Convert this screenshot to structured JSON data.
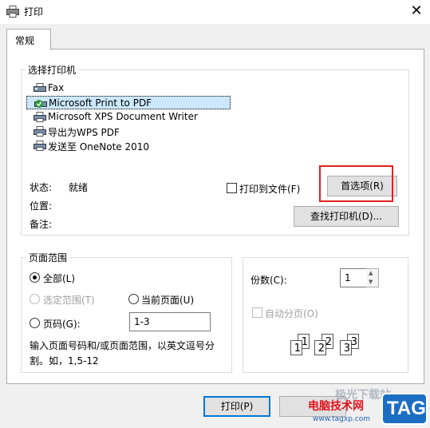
{
  "window": {
    "title": "打印",
    "close_icon": "close-icon"
  },
  "tabs": [
    {
      "label": "常规"
    }
  ],
  "select_printer": {
    "label": "选择打印机",
    "printers": [
      {
        "name": "Fax",
        "icon": "fax-printer-icon",
        "selected": false
      },
      {
        "name": "Microsoft Print to PDF",
        "icon": "default-printer-icon",
        "selected": true
      },
      {
        "name": "Microsoft XPS Document Writer",
        "icon": "printer-icon",
        "selected": false
      },
      {
        "name": "导出为WPS PDF",
        "icon": "printer-icon",
        "selected": false
      },
      {
        "name": "发送至 OneNote 2010",
        "icon": "printer-icon",
        "selected": false
      }
    ],
    "status_label": "状态:",
    "status_value": "就绪",
    "location_label": "位置:",
    "comment_label": "备注:",
    "print_to_file_label": "打印到文件(F)",
    "print_to_file_checked": false,
    "preferences_button": "首选项(R)",
    "find_printer_button": "查找打印机(D)..."
  },
  "page_range": {
    "label": "页面范围",
    "all_label": "全部(L)",
    "selection_label": "选定范围(T)",
    "current_page_label": "当前页面(U)",
    "pages_label": "页码(G):",
    "pages_value": "1-3",
    "help_text_1": "输入页面号码和/或页面范围，以英文逗号分",
    "help_text_2": "割。如，1,5-12",
    "selected": "all"
  },
  "copies": {
    "label": "份数(C):",
    "value": "1",
    "collate_label": "自动分页(O)",
    "collate_checked": false,
    "collate_pages": [
      "1",
      "1",
      "2",
      "2",
      "3",
      "3"
    ]
  },
  "footer": {
    "print_button": "打印(P)"
  },
  "watermark": {
    "brand": "电脑技术网",
    "url": "www.tagxp.com",
    "logo": "TAG",
    "top_text": "极光下载站"
  },
  "colors": {
    "selection": "#cce8ff",
    "highlight_box": "#e02020",
    "accent": "#0078d7"
  }
}
